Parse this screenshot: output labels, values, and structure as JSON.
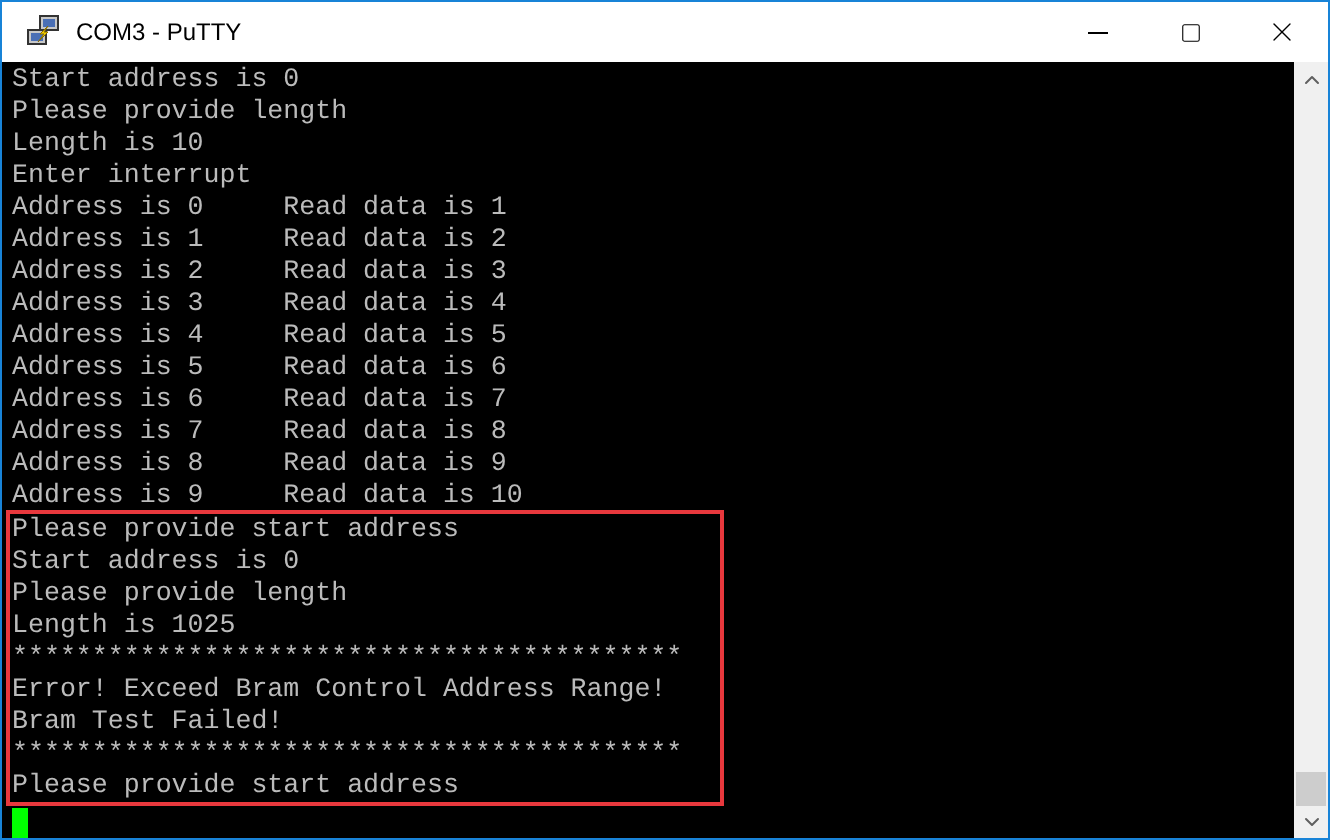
{
  "window": {
    "title": "COM3 - PuTTY"
  },
  "terminal": {
    "lines": [
      "Start address is 0",
      "Please provide length",
      "Length is 10",
      "Enter interrupt",
      "Address is 0     Read data is 1",
      "Address is 1     Read data is 2",
      "Address is 2     Read data is 3",
      "Address is 3     Read data is 4",
      "Address is 4     Read data is 5",
      "Address is 5     Read data is 6",
      "Address is 6     Read data is 7",
      "Address is 7     Read data is 8",
      "Address is 8     Read data is 9",
      "Address is 9     Read data is 10"
    ],
    "highlight_box": {
      "lines": [
        "Please provide start address",
        "Start address is 0",
        "Please provide length",
        "Length is 1025",
        "******************************************",
        "Error! Exceed Bram Control Address Range!",
        "Bram Test Failed!",
        "******************************************",
        "Please provide start address"
      ]
    },
    "cursor": true
  }
}
